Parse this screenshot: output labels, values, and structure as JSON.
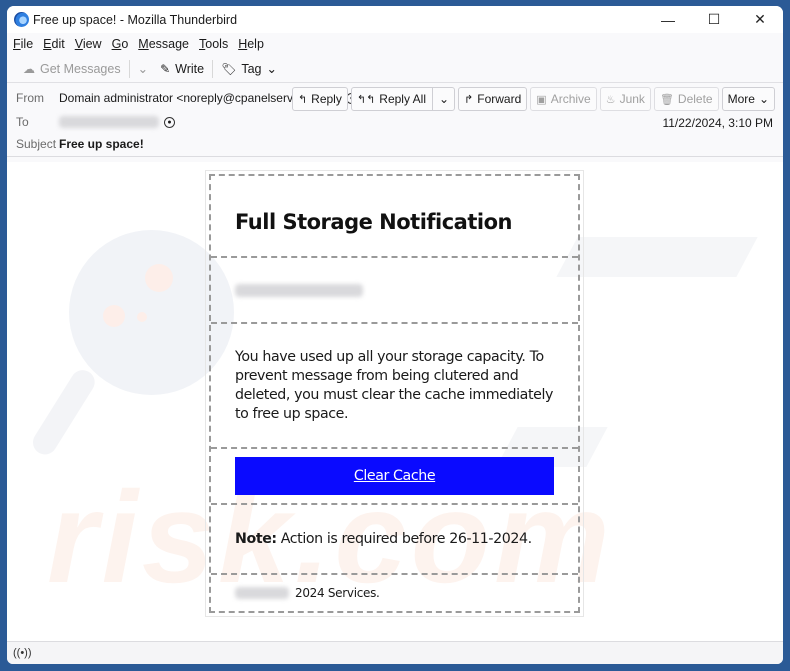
{
  "window": {
    "title": "Free up space! - Mozilla Thunderbird",
    "controls": {
      "minimize": "—",
      "maximize": "☐",
      "close": "✕"
    }
  },
  "menu": [
    {
      "label": "File",
      "accel": "F",
      "rest": "ile"
    },
    {
      "label": "Edit",
      "accel": "E",
      "rest": "dit"
    },
    {
      "label": "View",
      "accel": "V",
      "rest": "iew"
    },
    {
      "label": "Go",
      "accel": "G",
      "rest": "o"
    },
    {
      "label": "Message",
      "accel": "M",
      "rest": "essage"
    },
    {
      "label": "Tools",
      "accel": "T",
      "rest": "ools"
    },
    {
      "label": "Help",
      "accel": "H",
      "rest": "elp"
    }
  ],
  "toolbar": {
    "get_messages": "Get Messages",
    "write": "Write",
    "tag": "Tag"
  },
  "header": {
    "from_label": "From",
    "from_value": "Domain administrator <noreply@cpanelservice.com>",
    "to_label": "To",
    "to_value_redacted": true,
    "subject_label": "Subject",
    "subject_value": "Free up space!",
    "date": "11/22/2024, 3:10 PM",
    "actions": {
      "reply": "Reply",
      "reply_all": "Reply All",
      "forward": "Forward",
      "archive": "Archive",
      "junk": "Junk",
      "delete": "Delete",
      "more": "More"
    }
  },
  "email": {
    "heading": "Full Storage Notification",
    "recipient_redacted": true,
    "body": "You have used up all your storage capacity. To prevent message from being clutered and deleted, you must clear the cache immediately to free up space.",
    "cta_label": "Clear Cache",
    "cta_color": "#0a0aff",
    "note_label": "Note:",
    "note_text": "Action is required before 26-11-2024.",
    "footer_text": "2024 Services."
  },
  "watermark": {
    "text": "risk.com"
  },
  "statusbar": {
    "icon": "((•))"
  }
}
